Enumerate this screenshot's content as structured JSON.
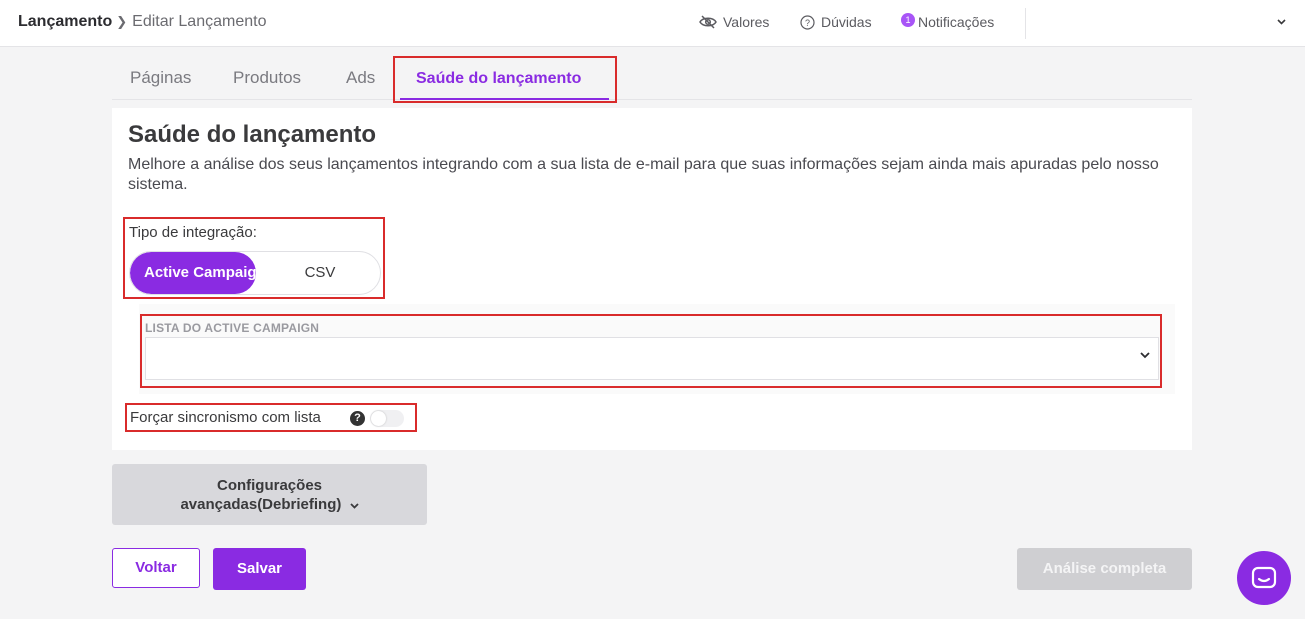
{
  "breadcrumb": {
    "root": "Lançamento",
    "separator": "❯",
    "current": "Editar Lançamento"
  },
  "topnav": {
    "valores": "Valores",
    "duvidas": "Dúvidas",
    "notificacoes": "Notificações",
    "notification_count": "1"
  },
  "tabs": [
    {
      "label": "Páginas"
    },
    {
      "label": "Produtos"
    },
    {
      "label": "Ads"
    },
    {
      "label": "Saúde do lançamento",
      "active": true
    }
  ],
  "card": {
    "title": "Saúde do lançamento",
    "description": "Melhore a análise dos seus lançamentos integrando com a sua lista de e-mail para que suas informações sejam ainda mais apuradas pelo nosso sistema."
  },
  "integration": {
    "label": "Tipo de integração:",
    "options": [
      "Active Campaign",
      "CSV"
    ],
    "selected": "Active Campaign"
  },
  "list": {
    "label": "LISTA DO ACTIVE CAMPAIGN",
    "value": ""
  },
  "sync": {
    "label": "Forçar sincronismo com lista",
    "help": "?",
    "enabled": false
  },
  "advanced": {
    "label_line1": "Configurações",
    "label_line2": "avançadas(Debriefing)",
    "chevron": "⌄"
  },
  "actions": {
    "back": "Voltar",
    "save": "Salvar",
    "analysis": "Análise completa"
  },
  "colors": {
    "accent": "#8a2be2",
    "highlight_border": "#d92b2b",
    "disabled": "#cfcfd2"
  },
  "icons": {
    "valores": "eye-off-icon",
    "duvidas": "question-circle-icon",
    "notificacoes": "notification-badge-icon",
    "user_menu": "chevron-down-icon",
    "select": "chevron-down-icon",
    "help": "help-icon",
    "chat": "chat-icon"
  }
}
